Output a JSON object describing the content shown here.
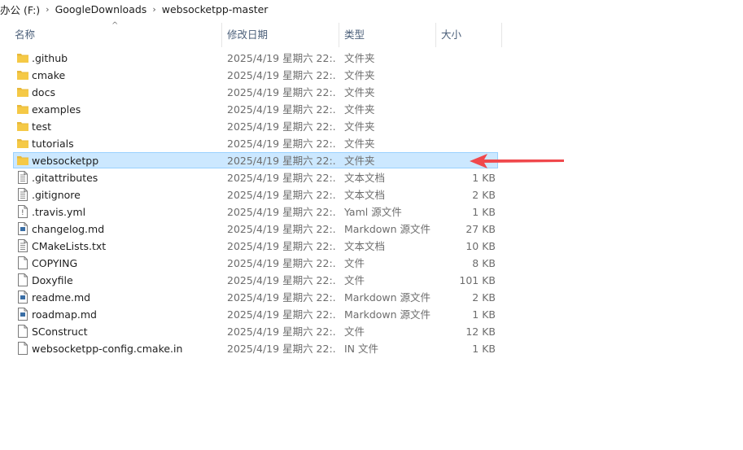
{
  "breadcrumb": {
    "items": [
      "办公 (F:)",
      "GoogleDownloads",
      "websocketpp-master"
    ],
    "separator": "›"
  },
  "columns": {
    "name": "名称",
    "date": "修改日期",
    "type": "类型",
    "size": "大小",
    "sort": "ascending"
  },
  "files": [
    {
      "name": ".github",
      "date": "2025/4/19 星期六 22:...",
      "type": "文件夹",
      "size": "",
      "icon": "folder-icon"
    },
    {
      "name": "cmake",
      "date": "2025/4/19 星期六 22:...",
      "type": "文件夹",
      "size": "",
      "icon": "folder-icon"
    },
    {
      "name": "docs",
      "date": "2025/4/19 星期六 22:...",
      "type": "文件夹",
      "size": "",
      "icon": "folder-icon"
    },
    {
      "name": "examples",
      "date": "2025/4/19 星期六 22:...",
      "type": "文件夹",
      "size": "",
      "icon": "folder-icon"
    },
    {
      "name": "test",
      "date": "2025/4/19 星期六 22:...",
      "type": "文件夹",
      "size": "",
      "icon": "folder-icon"
    },
    {
      "name": "tutorials",
      "date": "2025/4/19 星期六 22:...",
      "type": "文件夹",
      "size": "",
      "icon": "folder-icon"
    },
    {
      "name": "websocketpp",
      "date": "2025/4/19 星期六 22:...",
      "type": "文件夹",
      "size": "",
      "icon": "folder-icon",
      "selected": true
    },
    {
      "name": ".gitattributes",
      "date": "2025/4/19 星期六 22:...",
      "type": "文本文档",
      "size": "1 KB",
      "icon": "text-document-icon"
    },
    {
      "name": ".gitignore",
      "date": "2025/4/19 星期六 22:...",
      "type": "文本文档",
      "size": "2 KB",
      "icon": "text-document-icon"
    },
    {
      "name": ".travis.yml",
      "date": "2025/4/19 星期六 22:...",
      "type": "Yaml 源文件",
      "size": "1 KB",
      "icon": "yaml-file-icon"
    },
    {
      "name": "changelog.md",
      "date": "2025/4/19 星期六 22:...",
      "type": "Markdown 源文件",
      "size": "27 KB",
      "icon": "markdown-file-icon"
    },
    {
      "name": "CMakeLists.txt",
      "date": "2025/4/19 星期六 22:...",
      "type": "文本文档",
      "size": "10 KB",
      "icon": "text-document-icon"
    },
    {
      "name": "COPYING",
      "date": "2025/4/19 星期六 22:...",
      "type": "文件",
      "size": "8 KB",
      "icon": "blank-file-icon"
    },
    {
      "name": "Doxyfile",
      "date": "2025/4/19 星期六 22:...",
      "type": "文件",
      "size": "101 KB",
      "icon": "blank-file-icon"
    },
    {
      "name": "readme.md",
      "date": "2025/4/19 星期六 22:...",
      "type": "Markdown 源文件",
      "size": "2 KB",
      "icon": "markdown-file-icon"
    },
    {
      "name": "roadmap.md",
      "date": "2025/4/19 星期六 22:...",
      "type": "Markdown 源文件",
      "size": "1 KB",
      "icon": "markdown-file-icon"
    },
    {
      "name": "SConstruct",
      "date": "2025/4/19 星期六 22:...",
      "type": "文件",
      "size": "12 KB",
      "icon": "blank-file-icon"
    },
    {
      "name": "websocketpp-config.cmake.in",
      "date": "2025/4/19 星期六 22:...",
      "type": "IN 文件",
      "size": "1 KB",
      "icon": "blank-file-icon"
    }
  ],
  "colors": {
    "selection_bg": "#cce8ff",
    "selection_border": "#99d1ff",
    "folder": "#f5c946",
    "annotation_arrow": "#f0484c",
    "header_text": "#4c607a"
  },
  "annotation": {
    "icon": "red-arrow-icon",
    "points_to": "websocketpp"
  }
}
